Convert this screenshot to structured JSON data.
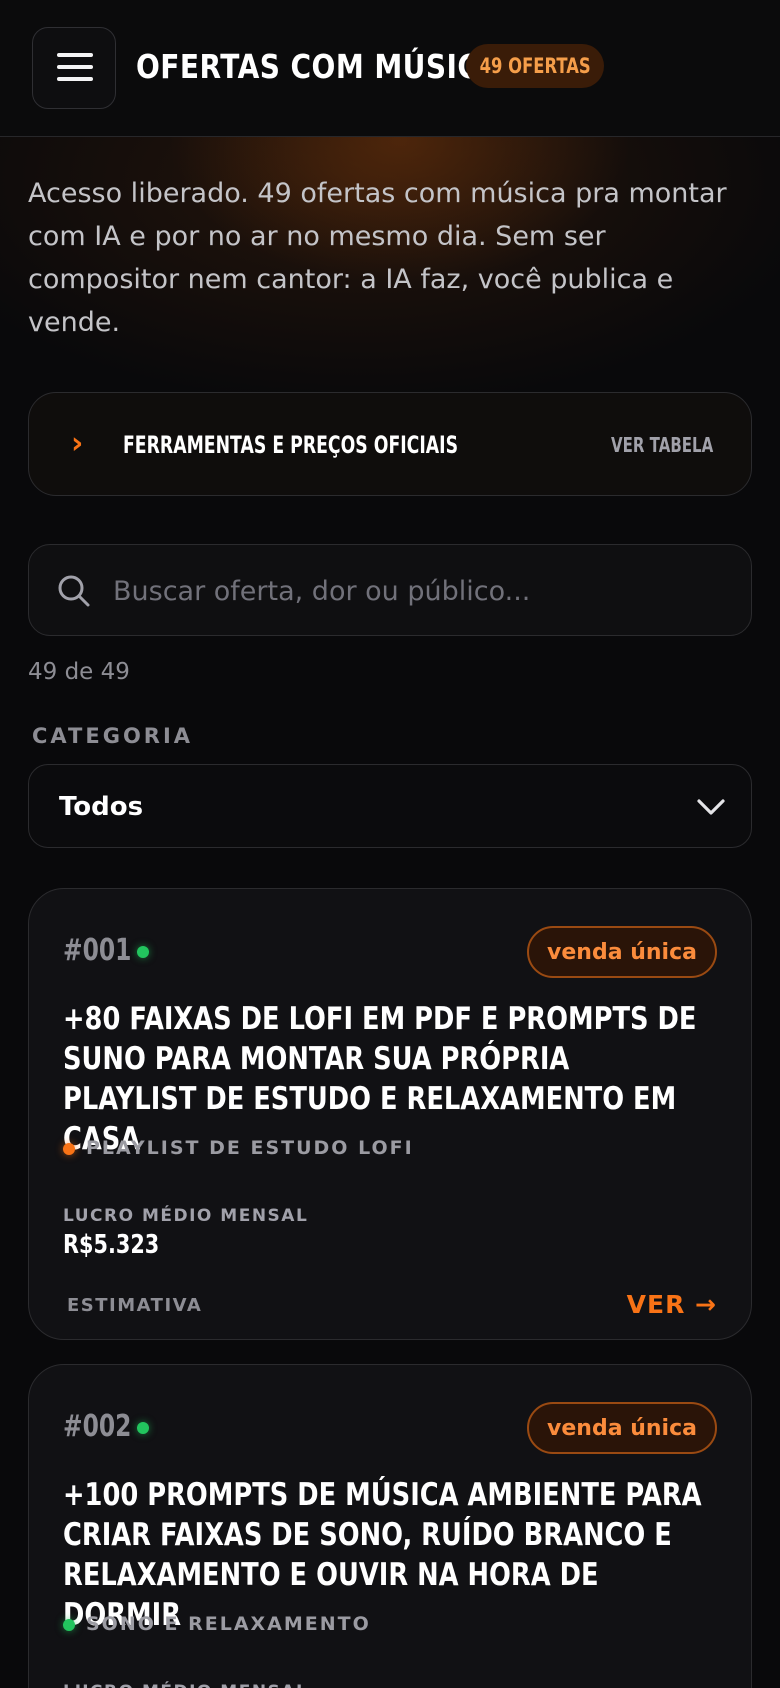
{
  "header": {
    "title": "OFERTAS COM MÚSICA",
    "count_badge": "49 OFERTAS"
  },
  "intro": "Acesso liberado. 49 ofertas com música pra montar com IA e por no ar no mesmo dia. Sem ser compositor nem cantor: a IA faz, você publica e vende.",
  "tools": {
    "label": "FERRAMENTAS E PREÇOS OFICIAIS",
    "link": "VER TABELA"
  },
  "search": {
    "placeholder": "Buscar oferta, dor ou público..."
  },
  "result_count": "49 de 49",
  "category": {
    "label": "CATEGORIA",
    "selected": "Todos"
  },
  "offers": [
    {
      "number": "#001",
      "type": "venda única",
      "title": "+80 faixas de lofi em PDF e prompts de Suno para montar sua própria playlist de estudo e relaxamento em casa",
      "category": "PLAYLIST DE ESTUDO LOFI",
      "category_color": "#f97316",
      "profit_label": "LUCRO MÉDIO MENSAL",
      "profit_value": "R$5.323",
      "estimate_label": "ESTIMATIVA",
      "view_label": "VER →"
    },
    {
      "number": "#002",
      "type": "venda única",
      "title": "+100 prompts de música ambiente para criar faixas de sono, ruído branco e relaxamento e ouvir na hora de dormir",
      "category": "SONO E RELAXAMENTO",
      "category_color": "#22c55e",
      "profit_label": "LUCRO MÉDIO MENSAL"
    }
  ],
  "colors": {
    "accent": "#f97316",
    "background": "#09090b",
    "live_indicator": "#22c55e"
  }
}
